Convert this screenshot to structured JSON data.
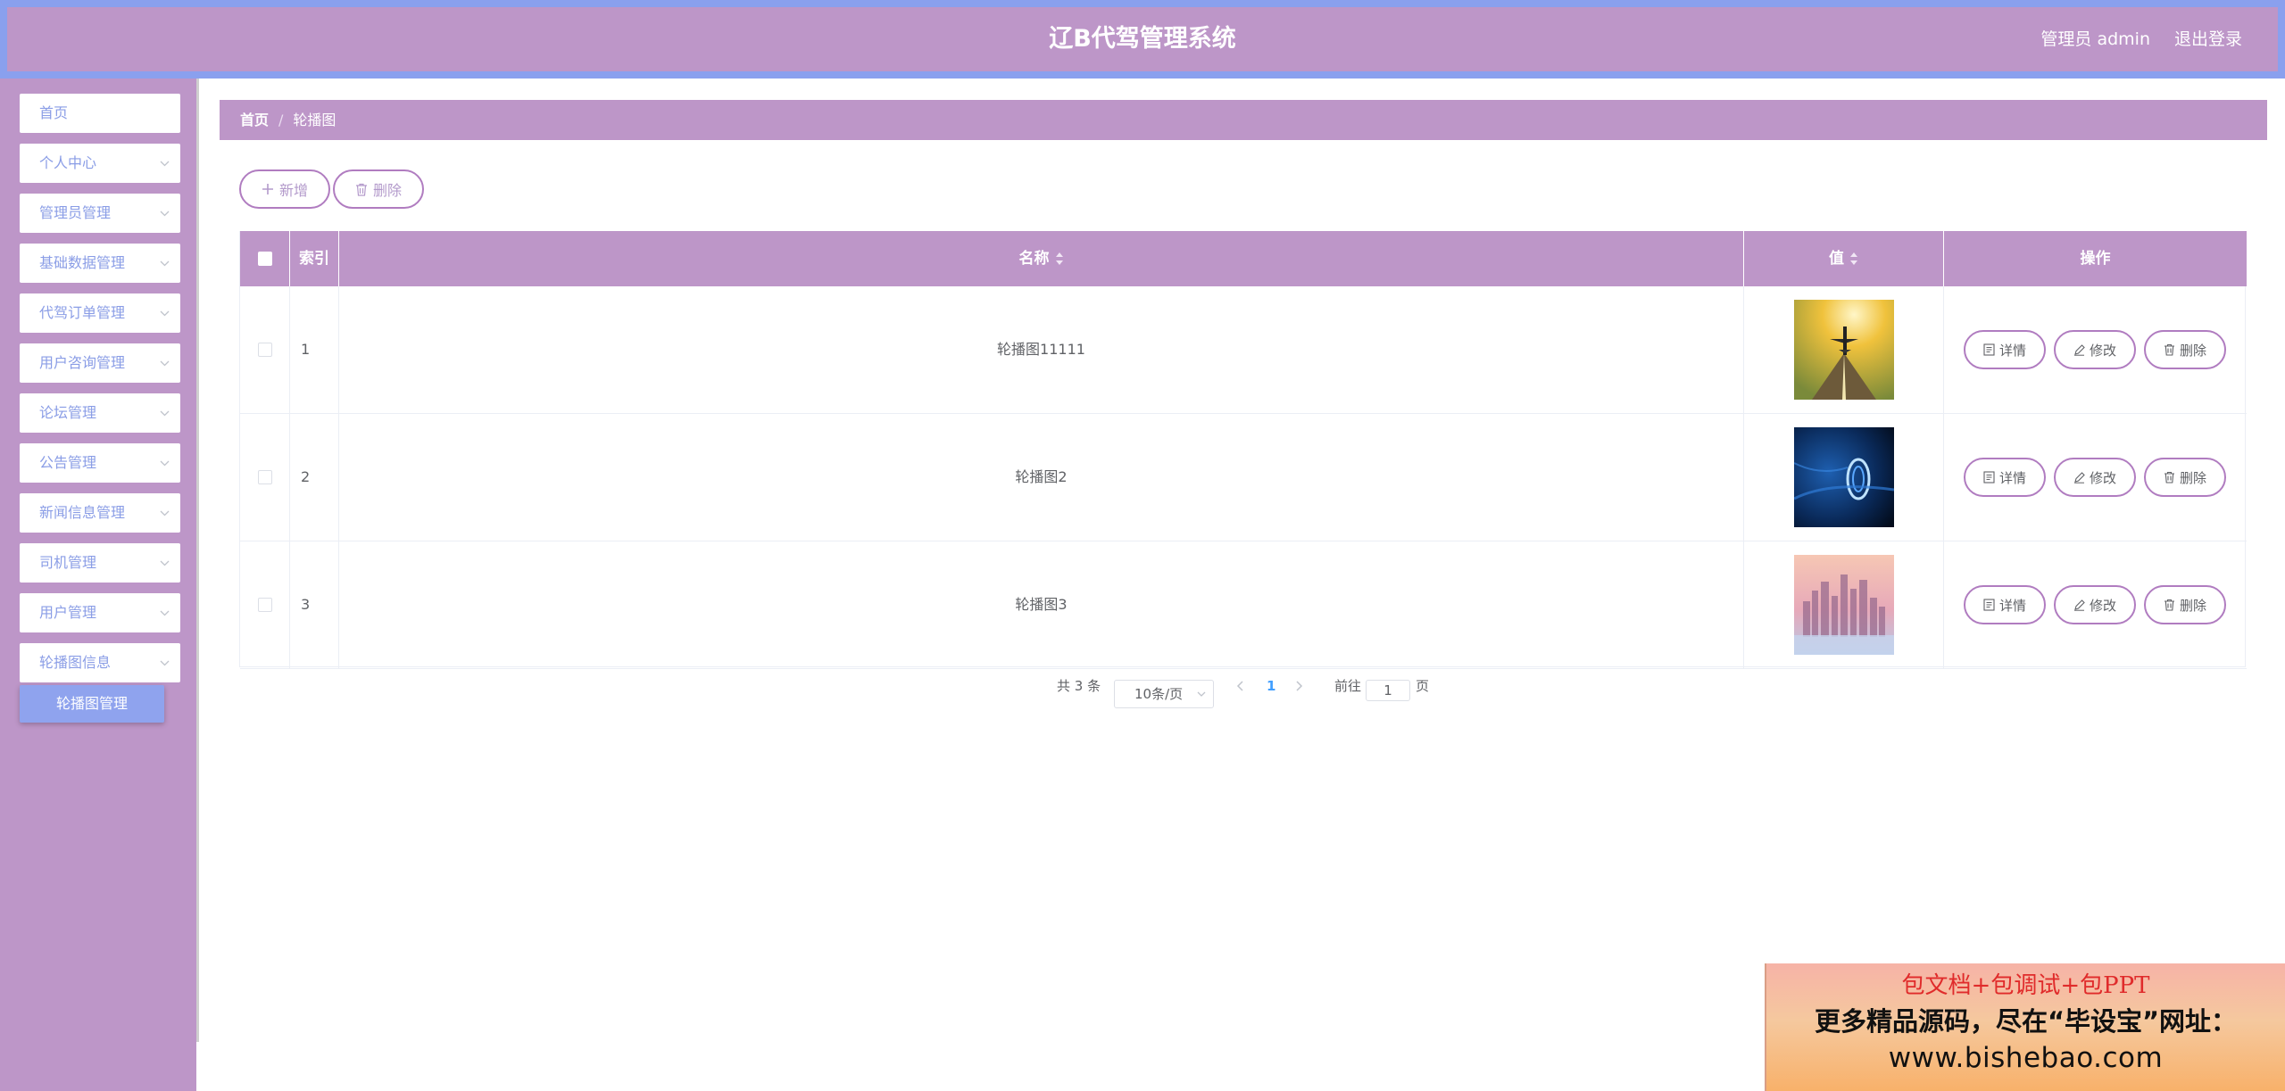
{
  "header": {
    "title": "辽B代驾管理系统",
    "user": "管理员 admin",
    "logout": "退出登录"
  },
  "sidebar": {
    "items": [
      {
        "label": "首页",
        "has_children": false
      },
      {
        "label": "个人中心",
        "has_children": true
      },
      {
        "label": "管理员管理",
        "has_children": true
      },
      {
        "label": "基础数据管理",
        "has_children": true
      },
      {
        "label": "代驾订单管理",
        "has_children": true
      },
      {
        "label": "用户咨询管理",
        "has_children": true
      },
      {
        "label": "论坛管理",
        "has_children": true
      },
      {
        "label": "公告管理",
        "has_children": true
      },
      {
        "label": "新闻信息管理",
        "has_children": true
      },
      {
        "label": "司机管理",
        "has_children": true
      },
      {
        "label": "用户管理",
        "has_children": true
      },
      {
        "label": "轮播图信息",
        "has_children": true
      }
    ],
    "active_sub": "轮播图管理"
  },
  "breadcrumb": {
    "home": "首页",
    "separator": "/",
    "current": "轮播图"
  },
  "toolbar": {
    "add_label": "新增",
    "delete_label": "删除"
  },
  "table": {
    "headers": {
      "index": "索引",
      "name": "名称",
      "value": "值",
      "actions": "操作"
    },
    "rows": [
      {
        "index": "1",
        "name": "轮播图11111",
        "image": "airplane"
      },
      {
        "index": "2",
        "name": "轮播图2",
        "image": "blue-ring"
      },
      {
        "index": "3",
        "name": "轮播图3",
        "image": "city-skyline"
      }
    ],
    "action_labels": {
      "detail": "详情",
      "edit": "修改",
      "delete": "删除"
    }
  },
  "pagination": {
    "total": "共 3 条",
    "page_size": "10条/页",
    "current_page": "1",
    "goto_prefix": "前往",
    "goto_value": "1",
    "goto_suffix": "页"
  },
  "promo": {
    "line1": "包文档+包调试+包PPT",
    "line2": "更多精品源码，尽在“毕设宝”网址：",
    "line3": "www.bishebao.com"
  },
  "colors": {
    "primary": "#bd96c8",
    "header_border": "#8aa0ee",
    "sidebar_text": "#8a9de6",
    "submenu_active": "#8fa3ee",
    "page_active": "#409eff"
  }
}
